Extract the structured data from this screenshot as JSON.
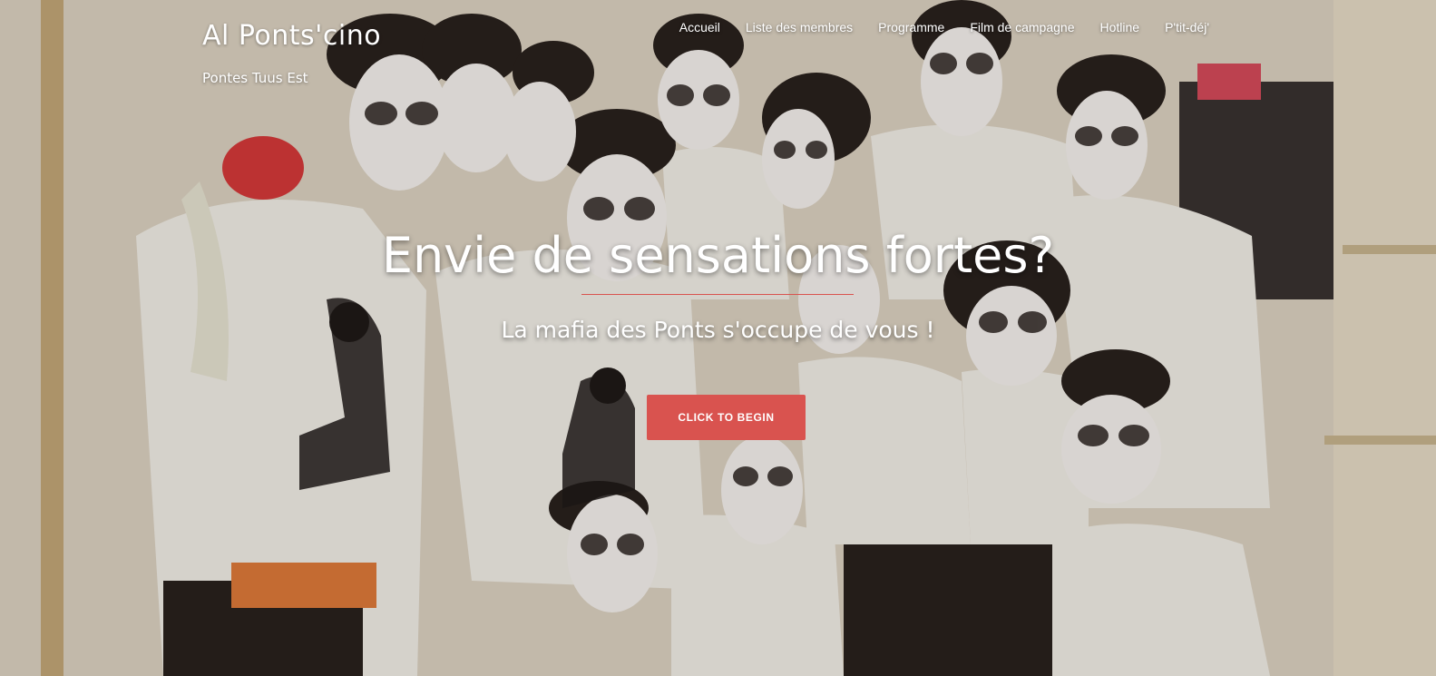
{
  "header": {
    "brand": "Al Ponts'cino",
    "tagline": "Pontes Tuus Est"
  },
  "nav": {
    "items": [
      {
        "label": "Accueil"
      },
      {
        "label": "Liste des membres"
      },
      {
        "label": "Programme"
      },
      {
        "label": "Film de campagne"
      },
      {
        "label": "Hotline"
      },
      {
        "label": "P'tit-déj'"
      }
    ]
  },
  "hero": {
    "headline": "Envie de sensations fortes?",
    "subheadline": "La mafia des Ponts s'occupe de vous !",
    "cta_label": "CLICK TO BEGIN"
  },
  "colors": {
    "accent": "#d9534f",
    "text": "#ffffff"
  },
  "background": {
    "description_icon": "group-photo-background"
  }
}
